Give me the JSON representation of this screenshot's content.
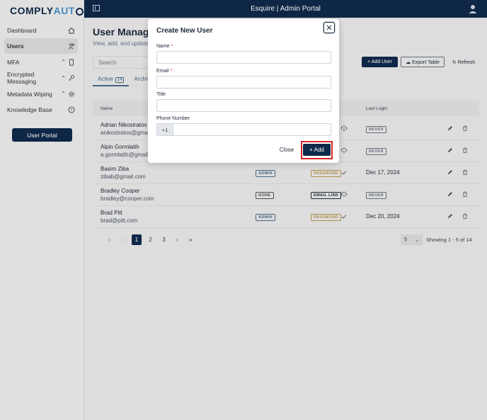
{
  "app": {
    "logo_part1": "COMPLY",
    "logo_part2": "AUT",
    "header_title": "Esquire | Admin Portal"
  },
  "sidebar": {
    "items": [
      {
        "label": "Dashboard",
        "icon": "home-icon"
      },
      {
        "label": "Users",
        "icon": "users-icon"
      },
      {
        "label": "MFA",
        "icon": "phone-icon"
      },
      {
        "label": "Encrypted Messaging",
        "icon": "key-icon"
      },
      {
        "label": "Metadata Wiping",
        "icon": "gear-icon"
      },
      {
        "label": "Knowledge Base",
        "icon": "help-icon"
      }
    ],
    "portal_button": "User Portal"
  },
  "main": {
    "title": "User Manag",
    "subtitle": "View, add, and update a",
    "search_placeholder": "Search",
    "add_user_label": "+ Add User",
    "export_label": "Export Table",
    "refresh_label": "Refresh",
    "tabs": [
      {
        "label": "Active",
        "count": "14"
      },
      {
        "label": "Archiv"
      }
    ],
    "columns": {
      "name": "Name",
      "last_login": "Last Login"
    },
    "rows": [
      {
        "name": "Adrian Nikostratos",
        "email": "anikostratos@gmail.com",
        "role": "",
        "method": "",
        "last_login": "NEVER"
      },
      {
        "name": "Alpin Gormlaith",
        "email": "a.gormlaith@gmail.c",
        "role": "",
        "method": "",
        "last_login": "NEVER"
      },
      {
        "name": "Basim Ziba",
        "email": "zibab@gmail.com",
        "role": "ADMIN",
        "method": "PASSWORD",
        "last_login": "Dec 17, 2024"
      },
      {
        "name": "Bradley Cooper",
        "email": "bradley@cooper.com",
        "role": "NONE",
        "method": "EMAIL LINK",
        "last_login": "NEVER"
      },
      {
        "name": "Brad Pitt",
        "email": "brad@pitt.com",
        "role": "ADMIN",
        "method": "PASSWORD",
        "last_login": "Dec 20, 2024"
      }
    ],
    "pager": {
      "first": "«",
      "prev": "‹",
      "pages": [
        "1",
        "2",
        "3"
      ],
      "next": "›",
      "last": "»"
    },
    "per_page": "5",
    "showing": "Showing 1 - 5 of 14"
  },
  "modal": {
    "title": "Create New User",
    "name_label": "Name",
    "email_label": "Email",
    "title_label": "Title",
    "phone_label": "Phone Number",
    "required_mark": "*",
    "phone_prefix": "+1",
    "close_label": "Close",
    "add_label": "+ Add"
  },
  "colors": {
    "navy": "#0f2a4a",
    "accent": "#4a90c8",
    "highlight": "#dc2626"
  }
}
